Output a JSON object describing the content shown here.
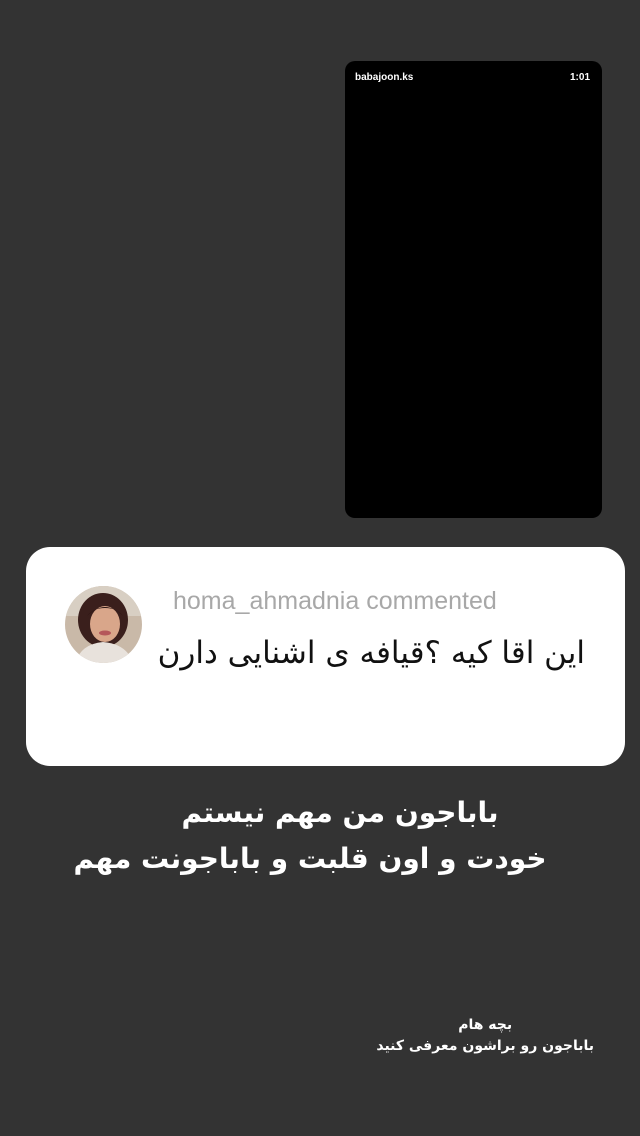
{
  "story": {
    "video": {
      "username": "babajoon.ks",
      "duration": "1:01"
    },
    "comment": {
      "header": "homa_ahmadnia commented",
      "text": "این اقا کیه ؟قیافه ی اشنایی دارن"
    },
    "reply": {
      "line1": "باباجون من مهم نیستم",
      "line2": "خودت و اون قلبت و باباجونت مهم"
    },
    "footnote": {
      "line1": "بچه هام",
      "line2": "باباجون رو براشون معرفی کنید"
    }
  },
  "colors": {
    "background": "#333333",
    "video": "#000000",
    "card": "#ffffff",
    "comment_header": "#a8a8a8"
  }
}
